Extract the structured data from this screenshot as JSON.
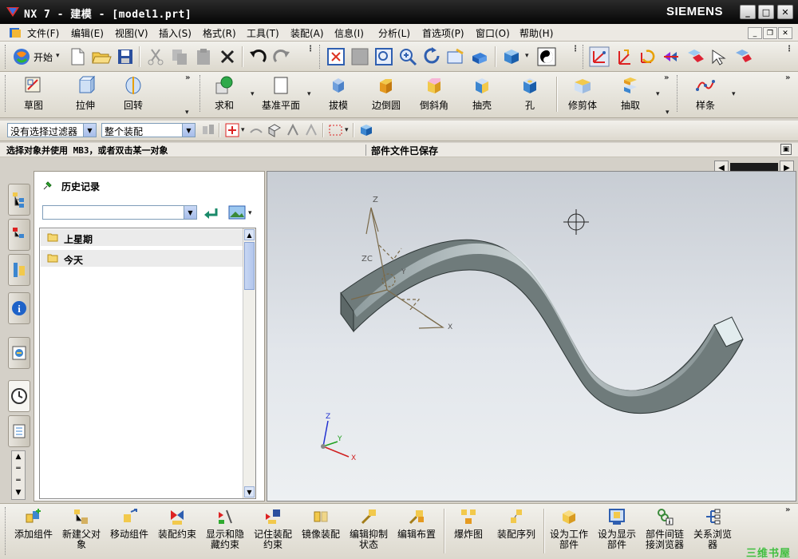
{
  "titlebar": {
    "title": "NX 7 - 建模 - [model1.prt]",
    "brand": "SIEMENS"
  },
  "menubar": {
    "items": [
      "文件(F)",
      "编辑(E)",
      "视图(V)",
      "插入(S)",
      "格式(R)",
      "工具(T)",
      "装配(A)",
      "信息(I)",
      "分析(L)",
      "首选项(P)",
      "窗口(O)",
      "帮助(H)"
    ]
  },
  "toolbar_standard": {
    "start_label": "开始"
  },
  "toolbar_features": {
    "tools": [
      "草图",
      "拉伸",
      "回转",
      "求和",
      "基准平面",
      "拔模",
      "边倒圆",
      "倒斜角",
      "抽壳",
      "孔",
      "修剪体",
      "抽取",
      "样条"
    ]
  },
  "selection_bar": {
    "filter_value": "没有选择过滤器",
    "scope_value": "整个装配"
  },
  "statusbar": {
    "prompt": "选择对象并使用 MB3，或者双击某一对象",
    "message": "部件文件已保存"
  },
  "navigator": {
    "title": "历史记录",
    "combo_value": "",
    "groups": [
      "上星期",
      "今天"
    ]
  },
  "viewport": {
    "axis_labels": {
      "z": "Z",
      "zc": "ZC",
      "y": "Y",
      "x": "X"
    }
  },
  "toolbar_assembly": {
    "tools": [
      [
        "添加组件"
      ],
      [
        "新建父对",
        "象"
      ],
      [
        "移动组件"
      ],
      [
        "装配约束"
      ],
      [
        "显示和隐",
        "藏约束"
      ],
      [
        "记住装配",
        "约束"
      ],
      [
        "镜像装配"
      ],
      [
        "编辑抑制",
        "状态"
      ],
      [
        "编辑布置"
      ],
      [
        "爆炸图"
      ],
      [
        "装配序列"
      ],
      [
        "设为工作",
        "部件"
      ],
      [
        "设为显示",
        "部件"
      ],
      [
        "部件间链",
        "接浏览器"
      ],
      [
        "关系浏览",
        "器"
      ]
    ]
  },
  "watermark": "三维书屋",
  "colors": {
    "titlebar": "#0a0a0a",
    "face": "#d4d0c8",
    "viewport_top": "#c8cdd4",
    "body_gray": "#6f7b7b",
    "body_light": "#dfe8ea"
  }
}
